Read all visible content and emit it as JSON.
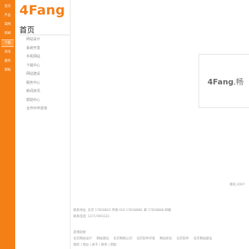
{
  "logo": "4Fang",
  "rail": {
    "items": [
      {
        "label": "首页"
      },
      {
        "label": "产品"
      },
      {
        "label": "案例"
      },
      {
        "label": "新闻"
      },
      {
        "label": "下载"
      },
      {
        "label": "资讯"
      },
      {
        "label": "服务"
      },
      {
        "label": "帮助"
      }
    ],
    "active_index": 4
  },
  "section_title": "首页",
  "subnav": [
    {
      "label": "网站设计"
    },
    {
      "label": "系统开发"
    },
    {
      "label": "手机网站"
    },
    {
      "label": "下载中心"
    },
    {
      "label": "网站建设"
    },
    {
      "label": "服务中心"
    },
    {
      "label": "新闻资讯"
    },
    {
      "label": "帮助中心"
    },
    {
      "label": "合作伙伴咨询"
    }
  ],
  "panel": {
    "brand": "4Fang",
    "suffix": ",畅"
  },
  "corner_note": "版权,2007",
  "footer": {
    "address_line": "联系地址: 北京 17818822 传真 010 17818888, 邮 17818888 邮箱",
    "contact_line": "联系电话: 13717893321",
    "links_title": "友情链接",
    "links": [
      "北京网站设计",
      "网站建设",
      "北京网络公司",
      "北京软件开发",
      "网站优化",
      "北京软件",
      "北京网站建设"
    ],
    "bottom_line": "版权 | 地址 | 关于 | 联系 | 帮助"
  },
  "colors": {
    "accent": "#f57f17",
    "rail_active": "#ff9a3c"
  }
}
